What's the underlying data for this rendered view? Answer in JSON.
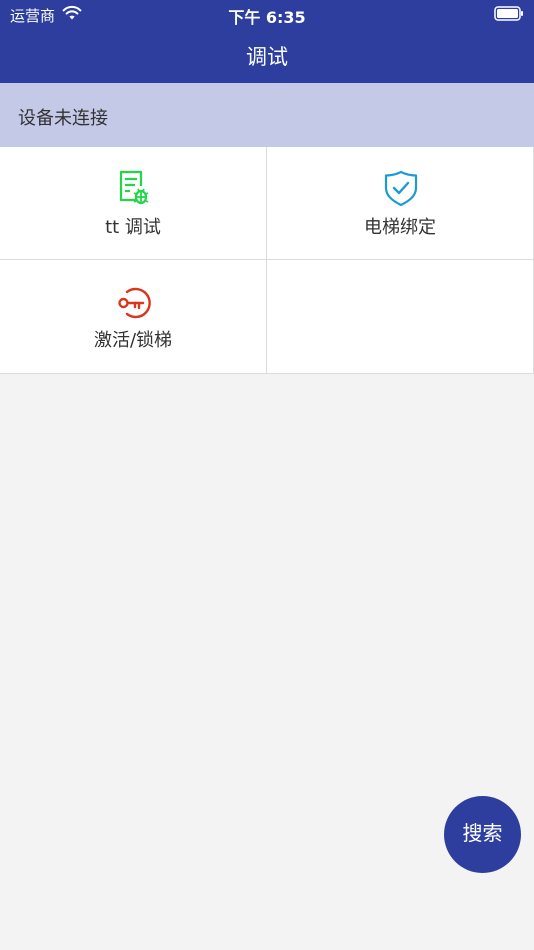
{
  "status_bar": {
    "carrier": "运营商",
    "time": "下午 6:35",
    "wifi_icon": "wifi-icon",
    "battery_icon": "battery-icon"
  },
  "nav": {
    "title": "调试"
  },
  "connection": {
    "status": "设备未连接"
  },
  "grid": {
    "items": [
      {
        "label": "tt 调试",
        "icon": "debug-document-icon",
        "color": "#22d64a"
      },
      {
        "label": "电梯绑定",
        "icon": "shield-check-icon",
        "color": "#1a9bd7"
      },
      {
        "label": "激活/锁梯",
        "icon": "key-icon",
        "color": "#d8361d"
      }
    ]
  },
  "fab": {
    "label": "搜索"
  },
  "colors": {
    "brand": "#2e3e9f",
    "banner": "#c5c9e8",
    "background": "#f3f3f3"
  }
}
